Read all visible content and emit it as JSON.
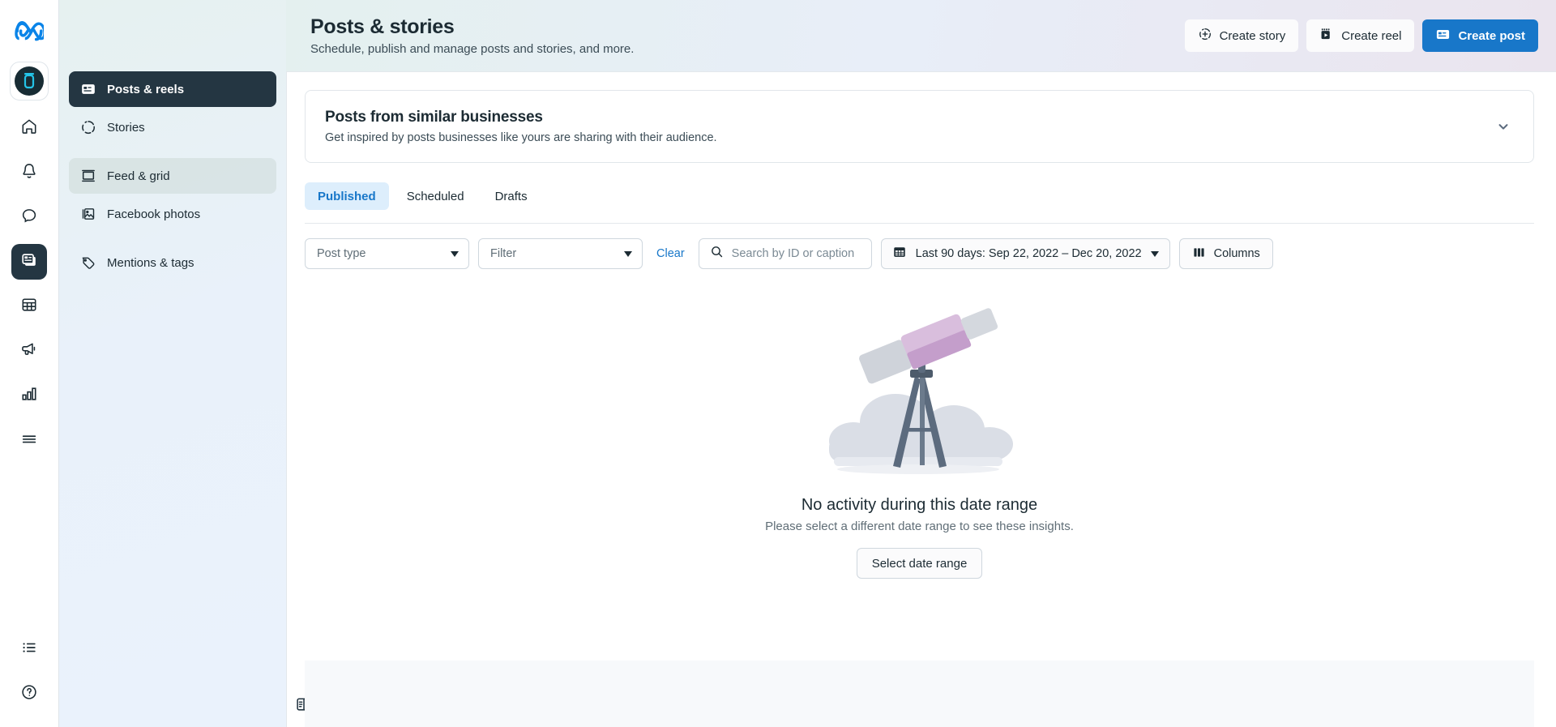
{
  "rail": {
    "logo": "meta-logo",
    "account_avatar": "business-account-avatar",
    "items": [
      {
        "icon": "home-icon",
        "name": "home",
        "active": false
      },
      {
        "icon": "bell-icon",
        "name": "notifications",
        "active": false
      },
      {
        "icon": "chat-bubble-icon",
        "name": "messages",
        "active": false
      },
      {
        "icon": "posts-icon",
        "name": "posts-and-stories",
        "active": true
      },
      {
        "icon": "table-icon",
        "name": "content-table",
        "active": false
      },
      {
        "icon": "megaphone-icon",
        "name": "ads",
        "active": false
      },
      {
        "icon": "bar-chart-icon",
        "name": "insights",
        "active": false
      },
      {
        "icon": "list-lines-icon",
        "name": "all-tools",
        "active": false
      }
    ],
    "bottom_items": [
      {
        "icon": "bulleted-list-icon",
        "name": "tasks"
      },
      {
        "icon": "help-circle-icon",
        "name": "help"
      }
    ]
  },
  "sidebar": {
    "items": [
      {
        "label": "Posts & reels",
        "icon": "posts-reels-icon",
        "state": "selected"
      },
      {
        "label": "Stories",
        "icon": "stories-ring-icon",
        "state": "plain"
      },
      {
        "label": "Feed & grid",
        "icon": "feed-grid-icon",
        "state": "hovered"
      },
      {
        "label": "Facebook photos",
        "icon": "photos-icon",
        "state": "plain"
      },
      {
        "label": "Mentions & tags",
        "icon": "tag-icon",
        "state": "plain"
      }
    ],
    "collapse_toggle": "panel-collapse-icon"
  },
  "header": {
    "title": "Posts & stories",
    "subtitle": "Schedule, publish and manage posts and stories, and more.",
    "actions": [
      {
        "label": "Create story",
        "icon": "create-story-icon",
        "variant": "secondary"
      },
      {
        "label": "Create reel",
        "icon": "create-reel-icon",
        "variant": "secondary"
      },
      {
        "label": "Create post",
        "icon": "create-post-icon",
        "variant": "primary"
      }
    ]
  },
  "promo": {
    "title": "Posts from similar businesses",
    "subtitle": "Get inspired by posts businesses like yours are sharing with their audience.",
    "expand_icon": "chevron-down-icon"
  },
  "tabs": [
    {
      "label": "Published",
      "active": true
    },
    {
      "label": "Scheduled",
      "active": false
    },
    {
      "label": "Drafts",
      "active": false
    }
  ],
  "filters": {
    "post_type_label": "Post type",
    "filter_label": "Filter",
    "clear_label": "Clear",
    "search_placeholder": "Search by ID or caption",
    "search_value": "",
    "date_range_label": "Last 90 days: Sep 22, 2022 – Dec 20, 2022",
    "columns_label": "Columns"
  },
  "empty_state": {
    "illustration": "telescope-illustration",
    "title": "No activity during this date range",
    "subtitle": "Please select a different date range to see these insights.",
    "button_label": "Select date range"
  },
  "colors": {
    "accent": "#1877c9",
    "selected_nav_bg": "#243642",
    "tab_active_bg": "#ddeefc",
    "border": "#cfd7de",
    "muted_text": "#606e77",
    "telescope_body": "#cfd3da",
    "telescope_barrel": "#d9bedd",
    "telescope_tripod": "#5c6b7e"
  }
}
